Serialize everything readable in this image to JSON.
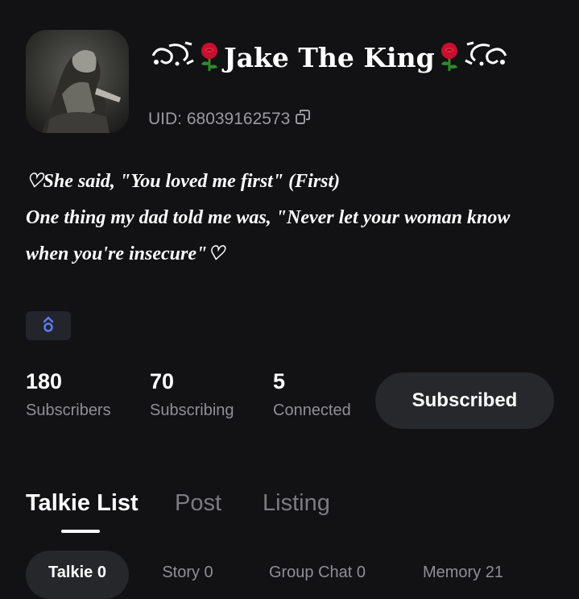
{
  "profile": {
    "name_text": "Jake The King",
    "uid": "UID: 68039162573",
    "bio_lines": [
      "♡She said, \"You loved me first\" (First)",
      "One thing my dad told me was, \"Never let your woman know",
      "when you're insecure\"♡"
    ]
  },
  "badge": {
    "icon": "rank-chevron-icon",
    "color": "#5b7cf0"
  },
  "stats": [
    {
      "value": "180",
      "label": "Subscribers"
    },
    {
      "value": "70",
      "label": "Subscribing"
    },
    {
      "value": "5",
      "label": "Connected"
    }
  ],
  "subscribe_button": {
    "label": "Subscribed"
  },
  "tabs": [
    {
      "label": "Talkie List",
      "active": true
    },
    {
      "label": "Post",
      "active": false
    },
    {
      "label": "Listing",
      "active": false
    }
  ],
  "chips": [
    {
      "label": "Talkie 0",
      "active": true
    },
    {
      "label": "Story 0",
      "active": false
    },
    {
      "label": "Group Chat 0",
      "active": false
    },
    {
      "label": "Memory 21",
      "active": false
    }
  ],
  "colors": {
    "background": "#121214",
    "muted_text": "#8f8f94",
    "rose": "#c8102e"
  }
}
